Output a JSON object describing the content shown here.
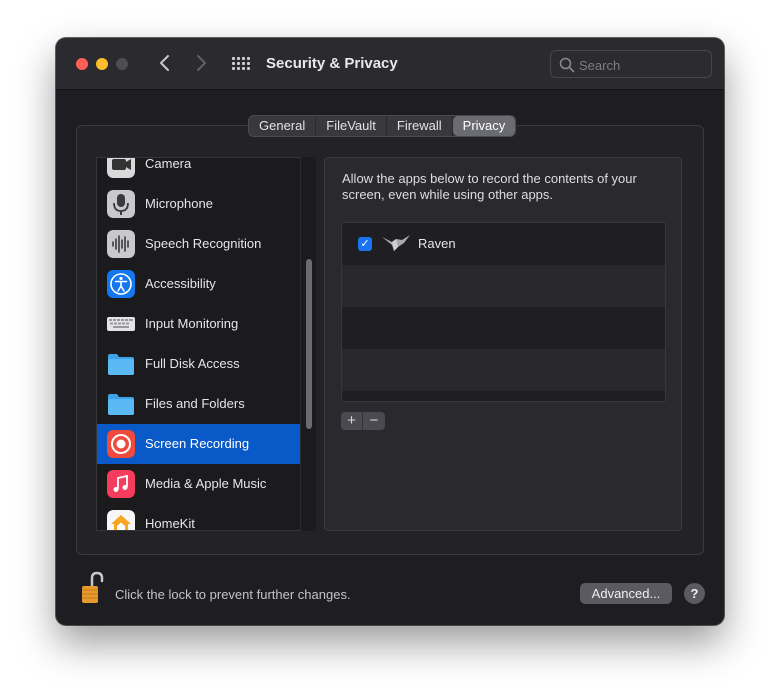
{
  "window": {
    "title": "Security & Privacy",
    "search_placeholder": "Search"
  },
  "tabs": [
    {
      "label": "General",
      "active": false
    },
    {
      "label": "FileVault",
      "active": false
    },
    {
      "label": "Firewall",
      "active": false
    },
    {
      "label": "Privacy",
      "active": true
    }
  ],
  "sidebar": {
    "items": [
      {
        "label": "Camera",
        "icon": "camera-icon",
        "selected": false
      },
      {
        "label": "Microphone",
        "icon": "microphone-icon",
        "selected": false
      },
      {
        "label": "Speech Recognition",
        "icon": "waveform-icon",
        "selected": false
      },
      {
        "label": "Accessibility",
        "icon": "accessibility-icon",
        "selected": false
      },
      {
        "label": "Input Monitoring",
        "icon": "keyboard-icon",
        "selected": false
      },
      {
        "label": "Full Disk Access",
        "icon": "folder-icon",
        "selected": false
      },
      {
        "label": "Files and Folders",
        "icon": "folder-icon",
        "selected": false
      },
      {
        "label": "Screen Recording",
        "icon": "screen-recording-icon",
        "selected": true
      },
      {
        "label": "Media & Apple Music",
        "icon": "music-icon",
        "selected": false
      },
      {
        "label": "HomeKit",
        "icon": "home-icon",
        "selected": false
      }
    ]
  },
  "detail": {
    "description": "Allow the apps below to record the contents of your screen, even while using other apps.",
    "apps": [
      {
        "name": "Raven",
        "checked": true,
        "icon": "raven-icon"
      }
    ],
    "add_label": "+",
    "remove_label": "−"
  },
  "footer": {
    "lock_text": "Click the lock to prevent further changes.",
    "advanced_label": "Advanced...",
    "help_label": "?"
  },
  "colors": {
    "accent": "#0a59c8",
    "checkbox": "#1a74f2",
    "window_bg": "#1e1e22"
  }
}
